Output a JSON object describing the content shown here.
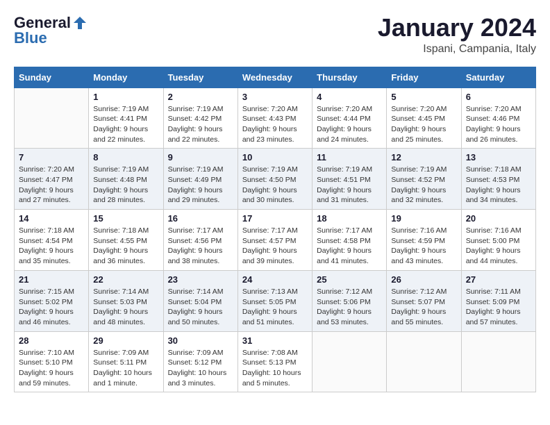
{
  "header": {
    "logo_line1": "General",
    "logo_line2": "Blue",
    "month": "January 2024",
    "location": "Ispani, Campania, Italy"
  },
  "weekdays": [
    "Sunday",
    "Monday",
    "Tuesday",
    "Wednesday",
    "Thursday",
    "Friday",
    "Saturday"
  ],
  "weeks": [
    [
      {
        "day": "",
        "sunrise": "",
        "sunset": "",
        "daylight": ""
      },
      {
        "day": "1",
        "sunrise": "Sunrise: 7:19 AM",
        "sunset": "Sunset: 4:41 PM",
        "daylight": "Daylight: 9 hours and 22 minutes."
      },
      {
        "day": "2",
        "sunrise": "Sunrise: 7:19 AM",
        "sunset": "Sunset: 4:42 PM",
        "daylight": "Daylight: 9 hours and 22 minutes."
      },
      {
        "day": "3",
        "sunrise": "Sunrise: 7:20 AM",
        "sunset": "Sunset: 4:43 PM",
        "daylight": "Daylight: 9 hours and 23 minutes."
      },
      {
        "day": "4",
        "sunrise": "Sunrise: 7:20 AM",
        "sunset": "Sunset: 4:44 PM",
        "daylight": "Daylight: 9 hours and 24 minutes."
      },
      {
        "day": "5",
        "sunrise": "Sunrise: 7:20 AM",
        "sunset": "Sunset: 4:45 PM",
        "daylight": "Daylight: 9 hours and 25 minutes."
      },
      {
        "day": "6",
        "sunrise": "Sunrise: 7:20 AM",
        "sunset": "Sunset: 4:46 PM",
        "daylight": "Daylight: 9 hours and 26 minutes."
      }
    ],
    [
      {
        "day": "7",
        "sunrise": "Sunrise: 7:20 AM",
        "sunset": "Sunset: 4:47 PM",
        "daylight": "Daylight: 9 hours and 27 minutes."
      },
      {
        "day": "8",
        "sunrise": "Sunrise: 7:19 AM",
        "sunset": "Sunset: 4:48 PM",
        "daylight": "Daylight: 9 hours and 28 minutes."
      },
      {
        "day": "9",
        "sunrise": "Sunrise: 7:19 AM",
        "sunset": "Sunset: 4:49 PM",
        "daylight": "Daylight: 9 hours and 29 minutes."
      },
      {
        "day": "10",
        "sunrise": "Sunrise: 7:19 AM",
        "sunset": "Sunset: 4:50 PM",
        "daylight": "Daylight: 9 hours and 30 minutes."
      },
      {
        "day": "11",
        "sunrise": "Sunrise: 7:19 AM",
        "sunset": "Sunset: 4:51 PM",
        "daylight": "Daylight: 9 hours and 31 minutes."
      },
      {
        "day": "12",
        "sunrise": "Sunrise: 7:19 AM",
        "sunset": "Sunset: 4:52 PM",
        "daylight": "Daylight: 9 hours and 32 minutes."
      },
      {
        "day": "13",
        "sunrise": "Sunrise: 7:18 AM",
        "sunset": "Sunset: 4:53 PM",
        "daylight": "Daylight: 9 hours and 34 minutes."
      }
    ],
    [
      {
        "day": "14",
        "sunrise": "Sunrise: 7:18 AM",
        "sunset": "Sunset: 4:54 PM",
        "daylight": "Daylight: 9 hours and 35 minutes."
      },
      {
        "day": "15",
        "sunrise": "Sunrise: 7:18 AM",
        "sunset": "Sunset: 4:55 PM",
        "daylight": "Daylight: 9 hours and 36 minutes."
      },
      {
        "day": "16",
        "sunrise": "Sunrise: 7:17 AM",
        "sunset": "Sunset: 4:56 PM",
        "daylight": "Daylight: 9 hours and 38 minutes."
      },
      {
        "day": "17",
        "sunrise": "Sunrise: 7:17 AM",
        "sunset": "Sunset: 4:57 PM",
        "daylight": "Daylight: 9 hours and 39 minutes."
      },
      {
        "day": "18",
        "sunrise": "Sunrise: 7:17 AM",
        "sunset": "Sunset: 4:58 PM",
        "daylight": "Daylight: 9 hours and 41 minutes."
      },
      {
        "day": "19",
        "sunrise": "Sunrise: 7:16 AM",
        "sunset": "Sunset: 4:59 PM",
        "daylight": "Daylight: 9 hours and 43 minutes."
      },
      {
        "day": "20",
        "sunrise": "Sunrise: 7:16 AM",
        "sunset": "Sunset: 5:00 PM",
        "daylight": "Daylight: 9 hours and 44 minutes."
      }
    ],
    [
      {
        "day": "21",
        "sunrise": "Sunrise: 7:15 AM",
        "sunset": "Sunset: 5:02 PM",
        "daylight": "Daylight: 9 hours and 46 minutes."
      },
      {
        "day": "22",
        "sunrise": "Sunrise: 7:14 AM",
        "sunset": "Sunset: 5:03 PM",
        "daylight": "Daylight: 9 hours and 48 minutes."
      },
      {
        "day": "23",
        "sunrise": "Sunrise: 7:14 AM",
        "sunset": "Sunset: 5:04 PM",
        "daylight": "Daylight: 9 hours and 50 minutes."
      },
      {
        "day": "24",
        "sunrise": "Sunrise: 7:13 AM",
        "sunset": "Sunset: 5:05 PM",
        "daylight": "Daylight: 9 hours and 51 minutes."
      },
      {
        "day": "25",
        "sunrise": "Sunrise: 7:12 AM",
        "sunset": "Sunset: 5:06 PM",
        "daylight": "Daylight: 9 hours and 53 minutes."
      },
      {
        "day": "26",
        "sunrise": "Sunrise: 7:12 AM",
        "sunset": "Sunset: 5:07 PM",
        "daylight": "Daylight: 9 hours and 55 minutes."
      },
      {
        "day": "27",
        "sunrise": "Sunrise: 7:11 AM",
        "sunset": "Sunset: 5:09 PM",
        "daylight": "Daylight: 9 hours and 57 minutes."
      }
    ],
    [
      {
        "day": "28",
        "sunrise": "Sunrise: 7:10 AM",
        "sunset": "Sunset: 5:10 PM",
        "daylight": "Daylight: 9 hours and 59 minutes."
      },
      {
        "day": "29",
        "sunrise": "Sunrise: 7:09 AM",
        "sunset": "Sunset: 5:11 PM",
        "daylight": "Daylight: 10 hours and 1 minute."
      },
      {
        "day": "30",
        "sunrise": "Sunrise: 7:09 AM",
        "sunset": "Sunset: 5:12 PM",
        "daylight": "Daylight: 10 hours and 3 minutes."
      },
      {
        "day": "31",
        "sunrise": "Sunrise: 7:08 AM",
        "sunset": "Sunset: 5:13 PM",
        "daylight": "Daylight: 10 hours and 5 minutes."
      },
      {
        "day": "",
        "sunrise": "",
        "sunset": "",
        "daylight": ""
      },
      {
        "day": "",
        "sunrise": "",
        "sunset": "",
        "daylight": ""
      },
      {
        "day": "",
        "sunrise": "",
        "sunset": "",
        "daylight": ""
      }
    ]
  ]
}
